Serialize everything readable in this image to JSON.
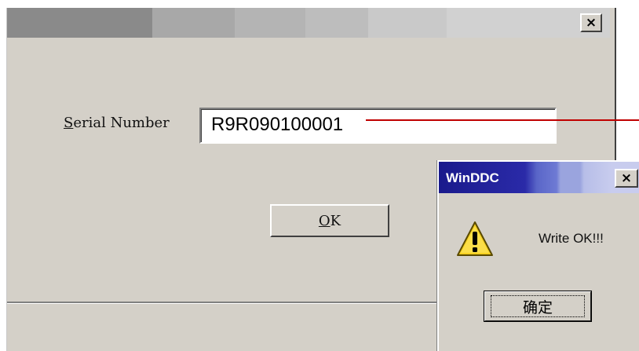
{
  "main_window": {
    "close_glyph": "×",
    "serial": {
      "label_accel": "S",
      "label_rest": "erial Number",
      "value": "R9R090100001"
    },
    "ok_button": {
      "label_accel": "O",
      "label_rest": "K"
    }
  },
  "popup": {
    "title": "WinDDC",
    "close_glyph": "×",
    "message": "Write OK!!!",
    "confirm_label": "确定",
    "icon": "warning-icon"
  },
  "colors": {
    "callout_line": "#c00000",
    "popup_title_start": "#1a1a8c"
  }
}
